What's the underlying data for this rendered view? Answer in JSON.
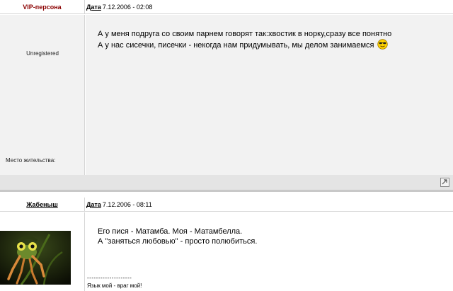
{
  "posts": [
    {
      "username": "VIP-персона",
      "date_label": "Дата",
      "date_value": "7.12.2006 - 02:08",
      "status": "Unregistered",
      "location_label": "Место жительства:",
      "message_lines": [
        "А у меня подруга со своим парнем говорят так:хвостик в норку,сразу все понятно",
        "А у нас сисечки, писечки - некогда нам придумывать, мы делом занимаемся"
      ],
      "emoticon": "cool-smiley-icon",
      "username_color": "#8b0000"
    },
    {
      "username": "Жабеныш",
      "date_label": "Дата",
      "date_value": "7.12.2006 - 08:11",
      "message_lines": [
        "Его пися - Матамба. Моя - Матамбелла.",
        "А \"заняться любовью\" - просто полюбиться."
      ],
      "signature_divider": "--------------------",
      "signature_text": "Язык мой - враг мой!"
    }
  ]
}
